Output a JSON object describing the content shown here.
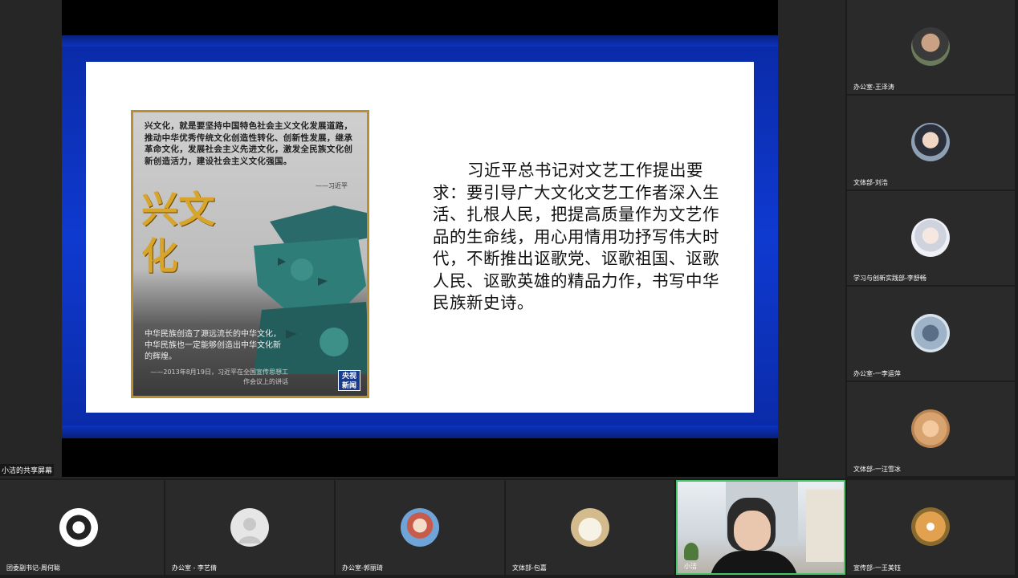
{
  "screen": {
    "label": "小洁的共享屏幕",
    "slide": {
      "poster": {
        "quote": "兴文化，就是要坚持中国特色社会主义文化发展道路，推动中华优秀传统文化创造性转化、创新性发展，继承革命文化，发展社会主义先进文化，激发全民族文化创新创造活力，建设社会主义文化强国。",
        "quote_sign": "——习近平",
        "big_title": "兴文化",
        "body": "中华民族创造了源远流长的中华文化，中华民族也一定能够创造出中华文化新的辉煌。",
        "footnote": "——2013年8月19日，习近平在全国宣传思想工作会议上的讲话",
        "logo": "央视新闻"
      },
      "text": "习近平总书记对文艺工作提出要求：要引导广大文化文艺工作者深入生活、扎根人民，把提高质量作为文艺作品的生命线，用心用情用功抒写伟大时代，不断推出讴歌党、讴歌祖国、讴歌人民、讴歌英雄的精品力作，书写中华民族新史诗。"
    }
  },
  "participants_right": [
    {
      "name": "办公室-王泽涛",
      "avatar": "photo-avatar"
    },
    {
      "name": "文体部-刘浩",
      "avatar": "anime-avatar"
    },
    {
      "name": "学习与创新实践部-李舒畅",
      "avatar": "anime-avatar"
    },
    {
      "name": "办公室-一李运萍",
      "avatar": "photo-avatar"
    },
    {
      "name": "文体部-一汪雪冰",
      "avatar": "photo-avatar"
    },
    {
      "name": "宣传部-一王美钰",
      "avatar": "dog-avatar"
    }
  ],
  "participants_bottom": [
    {
      "name": "团委副书记-周何聪",
      "avatar": "cartoon-avatar"
    },
    {
      "name": "办公室 - 李艺倩",
      "avatar": "default-user-icon"
    },
    {
      "name": "办公室-郭丽琦",
      "avatar": "anime-avatar"
    },
    {
      "name": "文体部-包嘉",
      "avatar": "cartoon-avatar"
    },
    {
      "name": "小洁",
      "avatar": "camera-video",
      "active": true
    }
  ],
  "colors": {
    "slide_frame": "#0f3ad0",
    "active_speaker_border": "#46c46a",
    "poster_gold": "#d8a52c"
  }
}
